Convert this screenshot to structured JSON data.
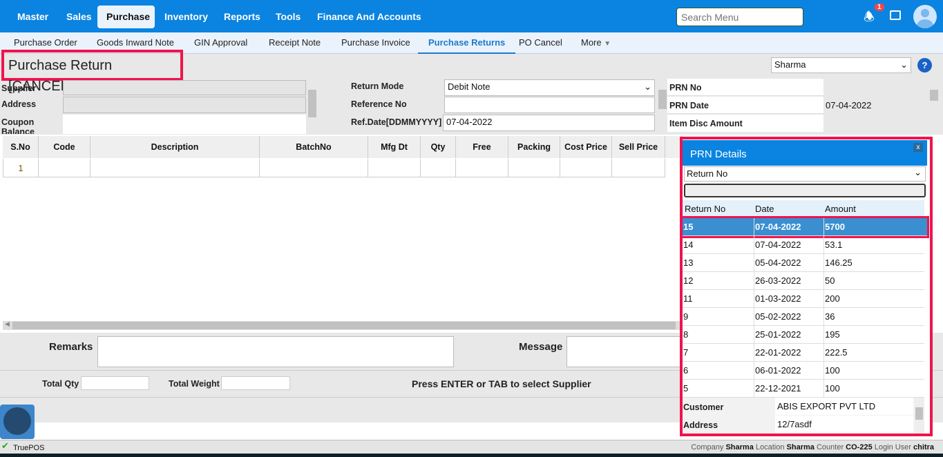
{
  "topnav": {
    "items": [
      "Master",
      "Sales",
      "Purchase",
      "Inventory",
      "Reports",
      "Tools",
      "Finance And Accounts"
    ],
    "active": "Purchase",
    "search_placeholder": "Search Menu",
    "notif_count": "1"
  },
  "subnav": {
    "items": [
      "Purchase Order",
      "Goods Inward Note",
      "GIN Approval",
      "Receipt Note",
      "Purchase Invoice",
      "Purchase Returns",
      "PO Cancel",
      "More"
    ],
    "active": "Purchase Returns"
  },
  "page": {
    "title": "Purchase Return [CANCEL]",
    "location_select": "Sharma",
    "help": "?"
  },
  "form": {
    "supplier_label": "Supplier",
    "address_label": "Address",
    "coupon_label": "Coupon Balance",
    "return_mode_label": "Return Mode",
    "return_mode_value": "Debit Note",
    "reference_label": "Reference No",
    "refdate_label": "Ref.Date[DDMMYYYY]",
    "refdate_value": "07-04-2022",
    "prn_no_label": "PRN No",
    "prn_date_label": "PRN Date",
    "prn_date_value": "07-04-2022",
    "item_disc_label": "Item Disc Amount"
  },
  "grid": {
    "columns": [
      "S.No",
      "Code",
      "Description",
      "BatchNo",
      "Mfg Dt",
      "Qty",
      "Free",
      "Packing",
      "Cost Price",
      "Sell Price"
    ],
    "rows": [
      [
        "1"
      ]
    ]
  },
  "footer": {
    "remarks_label": "Remarks",
    "message_label": "Message",
    "total_qty_label": "Total Qty",
    "total_weight_label": "Total Weight",
    "hint": "Press ENTER or TAB to select Supplier"
  },
  "popup": {
    "title": "PRN Details",
    "close": "x",
    "select_value": "Return No",
    "columns": [
      "Return No",
      "Date",
      "Amount"
    ],
    "rows": [
      [
        "15",
        "07-04-2022",
        "5700"
      ],
      [
        "14",
        "07-04-2022",
        "53.1"
      ],
      [
        "13",
        "05-04-2022",
        "146.25"
      ],
      [
        "12",
        "26-03-2022",
        "50"
      ],
      [
        "11",
        "01-03-2022",
        "200"
      ],
      [
        "9",
        "05-02-2022",
        "36"
      ],
      [
        "8",
        "25-01-2022",
        "195"
      ],
      [
        "7",
        "22-01-2022",
        "222.5"
      ],
      [
        "6",
        "06-01-2022",
        "100"
      ],
      [
        "5",
        "22-12-2021",
        "100"
      ]
    ],
    "customer_label": "Customer",
    "customer_value": "ABIS EXPORT PVT LTD",
    "address_label": "Address",
    "address_value": "12/7asdf"
  },
  "status": {
    "app": "TruePOS",
    "company_label": "Company",
    "company": "Sharma",
    "location_label": "Location",
    "location": "Sharma",
    "counter_label": "Counter",
    "counter": "CO-225",
    "user_label": "Login User",
    "user": "chitra"
  }
}
